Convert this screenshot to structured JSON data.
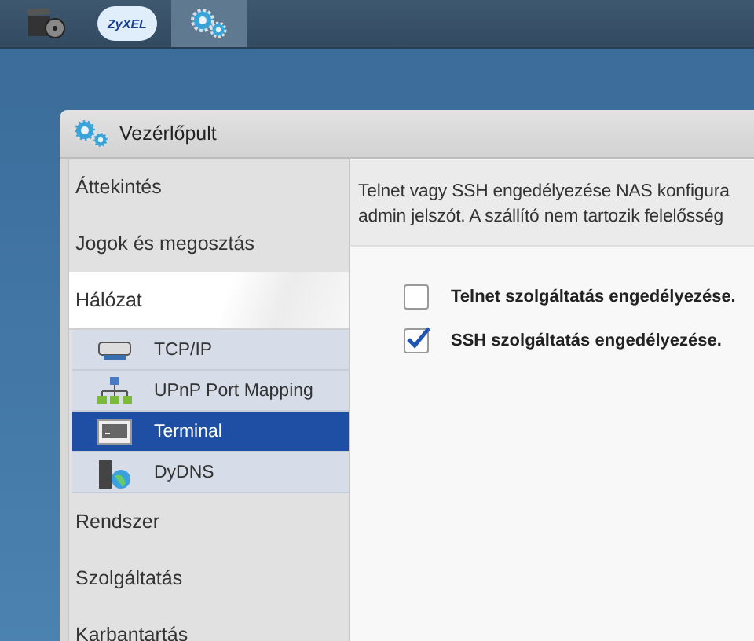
{
  "taskbar": {
    "apps": [
      {
        "kind": "video",
        "selected": false
      },
      {
        "kind": "cloud",
        "logo": "ZyXEL",
        "selected": false
      },
      {
        "kind": "gears",
        "selected": true
      }
    ]
  },
  "window": {
    "title": "Vezérlőpult"
  },
  "sidebar": {
    "items": [
      {
        "label": "Áttekintés",
        "expanded": false
      },
      {
        "label": "Jogok és megosztás",
        "expanded": false
      },
      {
        "label": "Hálózat",
        "expanded": true,
        "children": [
          {
            "label": "TCP/IP",
            "kind": "network",
            "selected": false
          },
          {
            "label": "UPnP Port Mapping",
            "kind": "upnp",
            "selected": false
          },
          {
            "label": "Terminal",
            "kind": "terminal",
            "selected": true
          },
          {
            "label": "DyDNS",
            "kind": "dns",
            "selected": false
          }
        ]
      },
      {
        "label": "Rendszer",
        "expanded": false
      },
      {
        "label": "Szolgáltatás",
        "expanded": false
      },
      {
        "label": "Karbantartás",
        "expanded": false
      }
    ]
  },
  "notice": {
    "lines": [
      "Telnet vagy SSH engedélyezése NAS konfigura",
      "admin jelszót. A szállító nem tartozik felelősség"
    ]
  },
  "options": [
    {
      "label": "Telnet szolgáltatás engedélyezése.",
      "checked": false
    },
    {
      "label": "SSH szolgáltatás engedélyezése.",
      "checked": true
    }
  ]
}
